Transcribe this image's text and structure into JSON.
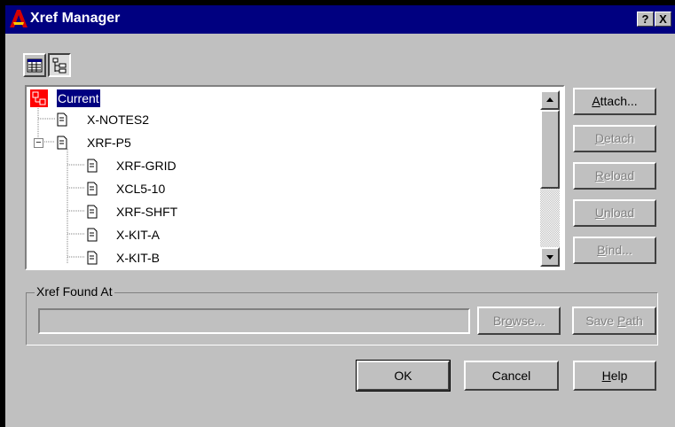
{
  "window": {
    "title": "Xref Manager",
    "help_button": "?",
    "close_button": "X"
  },
  "view_toggle": {
    "list_view": "list-view-icon",
    "tree_view": "tree-view-icon",
    "active": "tree_view"
  },
  "tree": {
    "root": "Current",
    "items": [
      {
        "label": "X-NOTES2"
      },
      {
        "label": "XRF-P5",
        "expand_symbol": "−"
      },
      {
        "label": "XRF-GRID"
      },
      {
        "label": "XCL5-10"
      },
      {
        "label": "XRF-SHFT"
      },
      {
        "label": "X-KIT-A"
      },
      {
        "label": "X-KIT-B"
      }
    ]
  },
  "buttons": {
    "attach": {
      "label": "Attach...",
      "mnemonic": "A",
      "rest": "ttach..."
    },
    "detach": {
      "label": "Detach",
      "mnemonic": "D",
      "rest": "etach"
    },
    "reload": {
      "label": "Reload",
      "mnemonic": "R",
      "rest": "eload"
    },
    "unload": {
      "label": "Unload",
      "mnemonic": "U",
      "rest": "nload"
    },
    "bind": {
      "label": "Bind...",
      "mnemonic": "B",
      "rest": "ind..."
    },
    "browse_pre": "Br",
    "browse_mn": "o",
    "browse_post": "wse...",
    "save_path_pre": "Save ",
    "save_path_mn": "P",
    "save_path_post": "ath",
    "ok": "OK",
    "cancel": "Cancel",
    "help_mn": "H",
    "help_rest": "elp"
  },
  "xref_found_at": {
    "label": "Xref Found At",
    "value": ""
  },
  "colors": {
    "titlebar": "#000080",
    "face": "#c0c0c0",
    "selection": "#000080",
    "current_icon": "#ff0000"
  }
}
